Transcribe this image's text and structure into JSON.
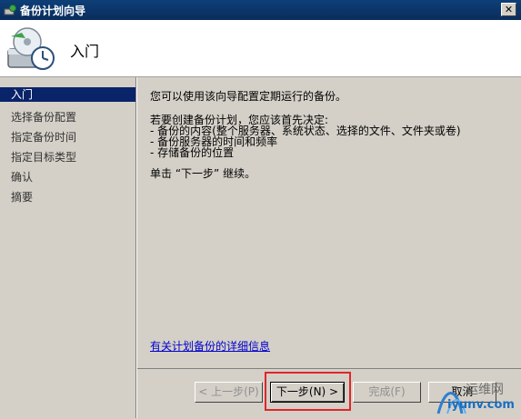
{
  "window": {
    "title": "备份计划向导",
    "close_label": "✕"
  },
  "header": {
    "title": "入门"
  },
  "sidebar": {
    "items": [
      {
        "label": "入门",
        "active": true
      },
      {
        "label": "选择备份配置"
      },
      {
        "label": "指定备份时间"
      },
      {
        "label": "指定目标类型"
      },
      {
        "label": "确认"
      },
      {
        "label": "摘要"
      }
    ]
  },
  "content": {
    "intro": "您可以使用该向导配置定期运行的备份。",
    "prereq": "若要创建备份计划，您应该首先决定:",
    "bullets": [
      "- 备份的内容(整个服务器、系统状态、选择的文件、文件夹或卷)",
      "- 备份服务器的时间和频率",
      "- 存储备份的位置"
    ],
    "next_hint": "单击 “下一步” 继续。",
    "info_link": "有关计划备份的详细信息"
  },
  "buttons": {
    "prev": "< 上一步(P)",
    "next": "下一步(N) >",
    "finish": "完成(F)",
    "cancel": "取消"
  },
  "watermark": {
    "title": "运维网",
    "url": "iyunv.com"
  }
}
